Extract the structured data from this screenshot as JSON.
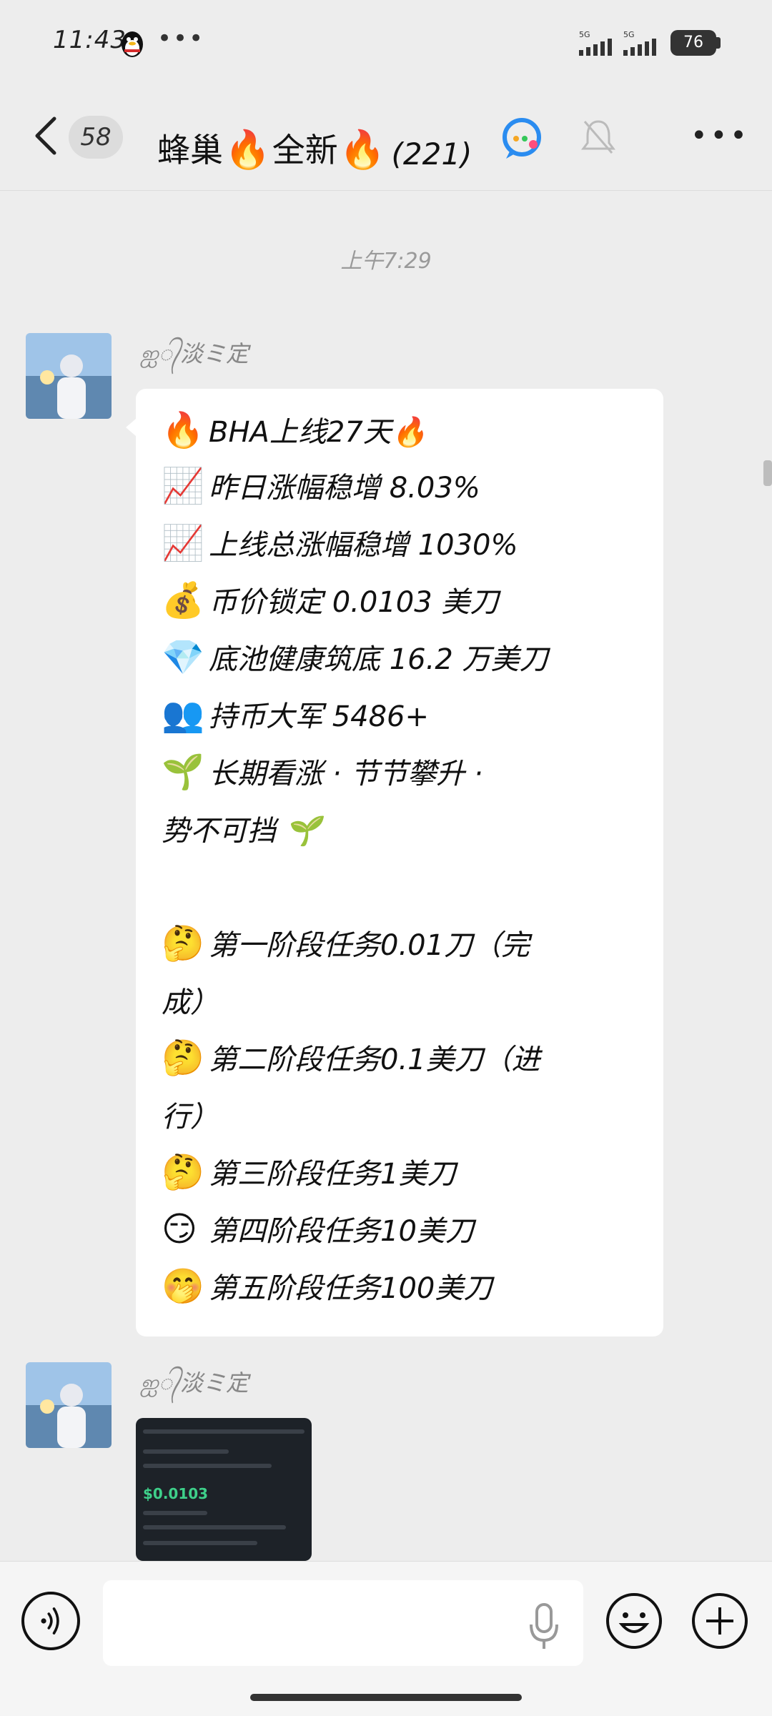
{
  "status_bar": {
    "time": "11:43",
    "dots": "•••",
    "signal_1_label": "5G",
    "signal_2_label": "5G",
    "battery": "76"
  },
  "nav": {
    "unread_count": "58",
    "group_name_part1": "蜂巢",
    "group_name_part2": "全新",
    "group_title_suffix": "(221)",
    "fire_emoji": "🔥",
    "more_label": "•••"
  },
  "timestamp": "上午7:29",
  "messages": [
    {
      "sender": "ஐ᭄淡ミ定",
      "lines": [
        {
          "emoji": "🔥",
          "text": "BHA上线27天🔥"
        },
        {
          "emoji": "📈",
          "text": "昨日涨幅稳增 8.03%"
        },
        {
          "emoji": "📈",
          "text": "上线总涨幅稳增 1030%"
        },
        {
          "emoji": "💰",
          "text": "币价锁定 0.0103 美刀"
        },
        {
          "emoji": "💎",
          "text": "底池健康筑底 16.2 万美刀"
        },
        {
          "emoji": "👥",
          "text": "持币大军 5486+"
        },
        {
          "emoji": "🌱",
          "text": "长期看涨 · 节节攀升 ·"
        },
        {
          "emoji": "",
          "text": "势不可挡 🌱"
        },
        {
          "emoji": "🤔",
          "text": "第一阶段任务0.01刀（完"
        },
        {
          "emoji": "",
          "text": "成）"
        },
        {
          "emoji": "🤔",
          "text": "第二阶段任务0.1美刀（进"
        },
        {
          "emoji": "",
          "text": "行）"
        },
        {
          "emoji": "🤔",
          "text": "第三阶段任务1美刀"
        },
        {
          "emoji": "😏",
          "text": "第四阶段任务10美刀"
        },
        {
          "emoji": "🤭",
          "text": "第五阶段任务100美刀"
        }
      ]
    },
    {
      "sender": "ஐ᭄淡ミ定",
      "image_price": "$0.0103"
    }
  ],
  "input": {
    "placeholder": ""
  },
  "colors": {
    "background": "#ededed",
    "bubble": "#ffffff",
    "mini_price_green": "#3ed08a"
  }
}
